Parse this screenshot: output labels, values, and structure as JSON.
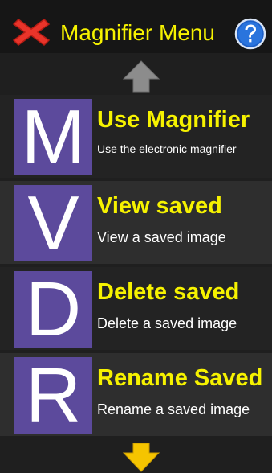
{
  "header": {
    "title": "Magnifier Menu",
    "close_icon": "red-x-icon",
    "help_icon": "question-mark-icon"
  },
  "nav": {
    "up_icon": "arrow-up-icon",
    "down_icon": "arrow-down-icon"
  },
  "menu": {
    "items": [
      {
        "letter": "M",
        "title": "Use Magnifier",
        "subtitle": "Use the electronic magnifier"
      },
      {
        "letter": "V",
        "title": "View saved",
        "subtitle": "View a saved image"
      },
      {
        "letter": "D",
        "title": "Delete saved",
        "subtitle": "Delete a saved image"
      },
      {
        "letter": "R",
        "title": "Rename Saved",
        "subtitle": "Rename a saved image"
      }
    ]
  },
  "colors": {
    "title_yellow": "#f6f200",
    "tile_purple": "#5c4a9c",
    "background": "#1f1f1f",
    "close_red": "#e8342a",
    "help_blue": "#1d5fc7",
    "up_arrow_gray": "#8c8c8c",
    "down_arrow_yellow": "#f5c400"
  }
}
